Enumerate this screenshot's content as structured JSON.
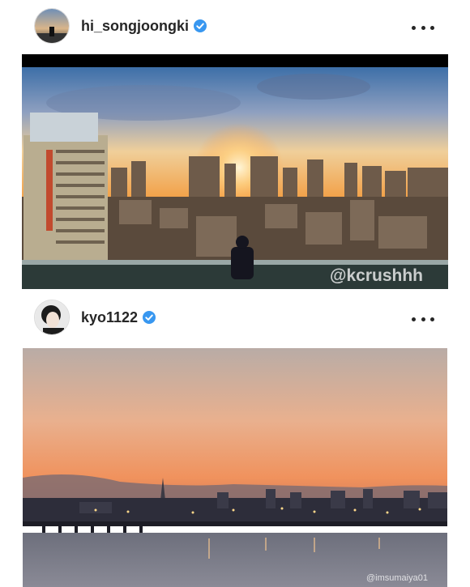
{
  "posts": [
    {
      "username": "hi_songjoongki",
      "verified": true,
      "more_label": "more options",
      "photo_watermark": "@kcrushhh",
      "photo_description": "city skyline at sunset from rooftop"
    },
    {
      "username": "kyo1122",
      "verified": true,
      "more_label": "more options",
      "photo_watermark": "@imsumaiya01",
      "photo_description": "river and city skyline at dusk"
    }
  ],
  "colors": {
    "verified_badge": "#3897f0",
    "text": "#262626"
  }
}
